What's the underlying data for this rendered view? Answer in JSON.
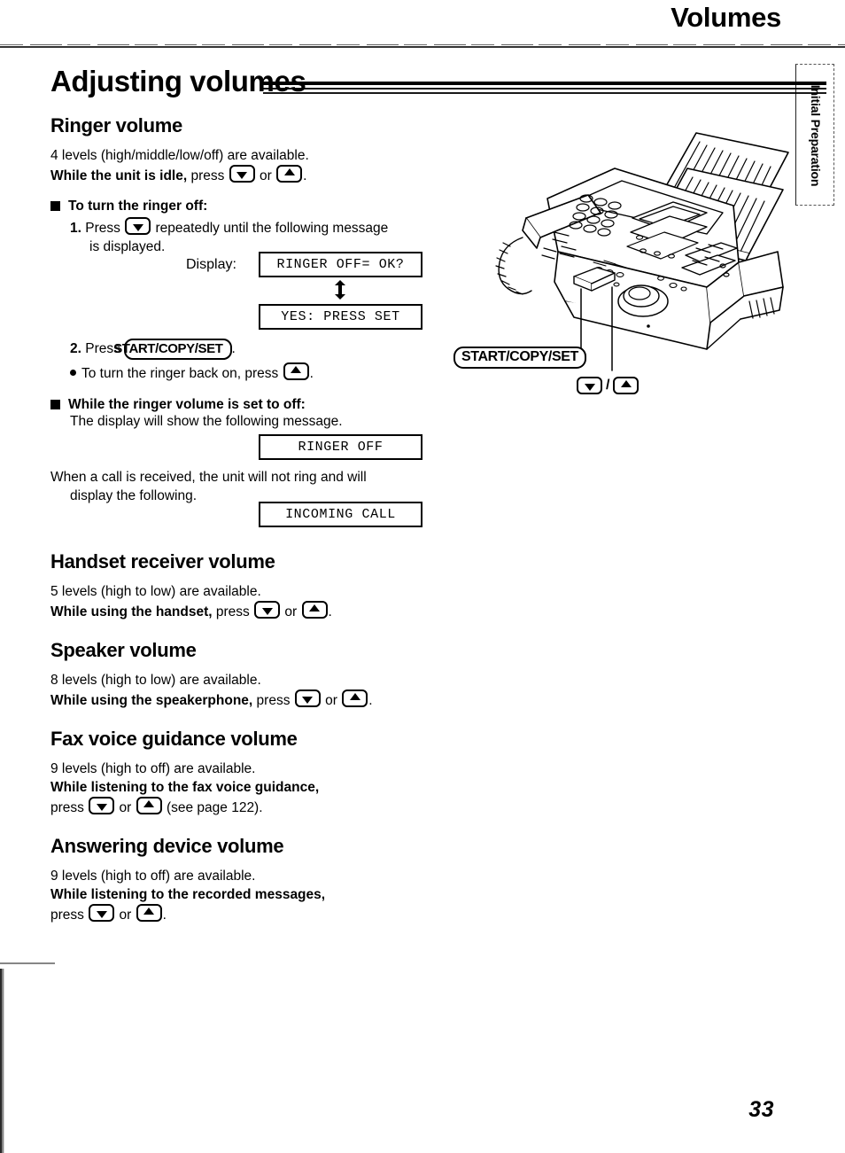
{
  "header": {
    "running_title": "Volumes",
    "side_tab": "Initial Preparation"
  },
  "title": "Adjusting volumes",
  "page_number": "33",
  "keys": {
    "down": "down-arrow-key",
    "up": "up-arrow-key",
    "start_copy_set": "START/COPY/SET"
  },
  "sections": [
    {
      "id": "ringer-volume",
      "heading": "Ringer volume",
      "levels_line": "4 levels (high/middle/low/off) are available.",
      "action_bold": "While the unit is idle,",
      "action_rest": "press",
      "action_join": "or",
      "action_end": "."
    },
    {
      "id": "handset-receiver-volume",
      "heading": "Handset receiver volume",
      "levels_line": "5 levels (high to low) are available.",
      "action_bold": "While using the handset,",
      "action_rest": "press",
      "action_join": "or",
      "action_end": "."
    },
    {
      "id": "speaker-volume",
      "heading": "Speaker volume",
      "levels_line": "8 levels (high to low) are available.",
      "action_bold": "While using the speakerphone,",
      "action_rest": "press",
      "action_join": "or",
      "action_end": "."
    },
    {
      "id": "fax-voice-guidance-volume",
      "heading": "Fax voice guidance volume",
      "levels_line": "9 levels (high to off) are available.",
      "action_bold": "While listening to the fax voice guidance,",
      "action_rest": "press",
      "action_join": "or",
      "action_end": "(see page 122)."
    },
    {
      "id": "answering-device-volume",
      "heading": "Answering device volume",
      "levels_line": "9 levels (high to off) are available.",
      "action_bold": "While listening to the recorded messages,",
      "action_rest": "press",
      "action_join": "or",
      "action_end": "."
    }
  ],
  "turn_off": {
    "heading": "To turn the ringer off:",
    "step1_num": "1.",
    "step1_a": "Press",
    "step1_b": "repeatedly until the following message",
    "step1_c": "is displayed.",
    "display_label": "Display:",
    "display_1": "RINGER OFF= OK?",
    "display_2": "YES: PRESS SET",
    "step2_num": "2.",
    "step2_a": "Press",
    "step2_key": "START/COPY/SET",
    "step2_end": ".",
    "note_a": "To turn the ringer back on, press",
    "note_end": "."
  },
  "ringer_off_state": {
    "heading": "While the ringer volume is set to off:",
    "line1": "The display will show the following message.",
    "display_1": "RINGER OFF",
    "line2a": "When a call is received, the unit will not ring and will",
    "line2b": "display the following.",
    "display_2": "INCOMING CALL"
  },
  "illustration": {
    "alt": "fax-machine-line-drawing",
    "callout_set": "START/COPY/SET",
    "callout_volume_sep": "/"
  },
  "colors": {
    "ink": "#000000",
    "paper": "#ffffff"
  }
}
